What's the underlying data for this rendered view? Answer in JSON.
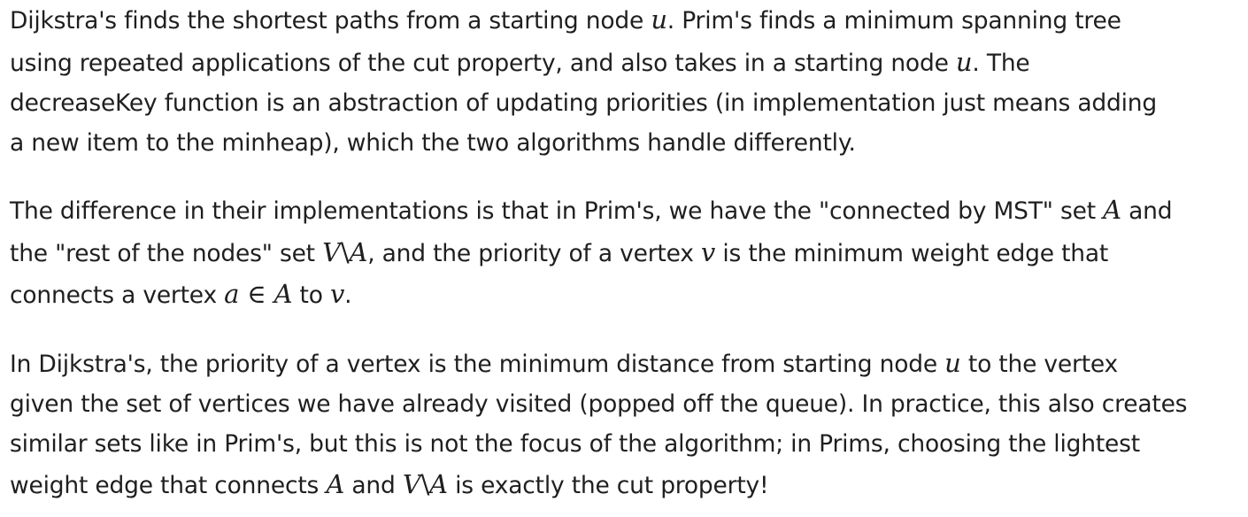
{
  "paragraphs": [
    {
      "lines": [
        {
          "t1": "Dijkstra's finds the shortest paths from a starting node ",
          "m1": "u",
          "t2": ". Prim's finds a minimum spanning tree"
        },
        {
          "t1": "using repeated applications of the cut property, and also takes in a starting node ",
          "m1": "u",
          "t2": ". The"
        },
        {
          "t1": "decreaseKey function is an abstraction of updating priorities (in implementation just means adding"
        },
        {
          "t1": "a new item to the minheap), which the two algorithms handle differently."
        }
      ]
    },
    {
      "lines": [
        {
          "t1": "The difference in their implementations is that in Prim's, we have the \"connected by MST\" set ",
          "m1": "A",
          "t2": " and"
        },
        {
          "t1": "the \"rest of the nodes\" set ",
          "m1a": "V",
          "m1op": "\\",
          "m1b": "A",
          "t2": ", and the priority of a vertex ",
          "m2": "v",
          "t3": " is the minimum weight edge that"
        },
        {
          "t1": "connects a vertex ",
          "m1a": "a",
          "m1op": " ∈ ",
          "m1b": "A",
          "t2": " to ",
          "m2": "v",
          "t3": "."
        }
      ]
    },
    {
      "lines": [
        {
          "t1": "In Dijkstra's, the priority of a vertex is the minimum distance from starting node ",
          "m1": "u",
          "t2": " to the vertex"
        },
        {
          "t1": "given the set of vertices we have already visited (popped off the queue). In practice, this also creates"
        },
        {
          "t1": "similar sets like in Prim's, but this is not the focus of the algorithm; in Prims, choosing the lightest"
        },
        {
          "t1": "weight edge that connects ",
          "m1": "A",
          "t2": " and ",
          "m2a": "V",
          "m2op": "\\",
          "m2b": "A",
          "t3": " is exactly the cut property!"
        }
      ]
    }
  ]
}
